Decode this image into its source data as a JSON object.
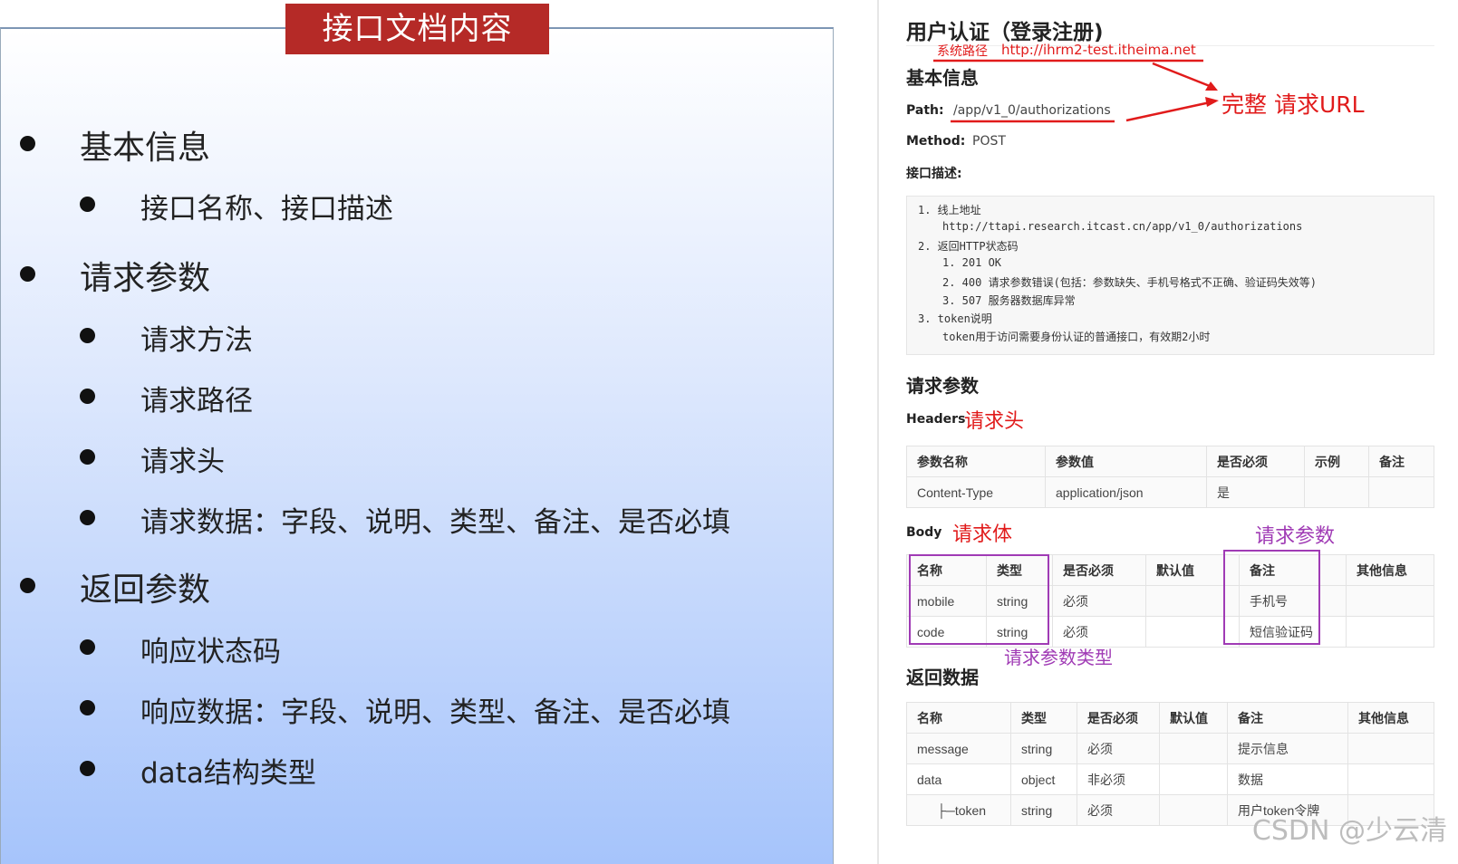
{
  "left": {
    "title": "接口文档内容",
    "sections": [
      {
        "label": "基本信息",
        "items": [
          "接口名称、接口描述"
        ]
      },
      {
        "label": "请求参数",
        "items": [
          "请求方法",
          "请求路径",
          "请求头",
          "请求数据：字段、说明、类型、备注、是否必填"
        ]
      },
      {
        "label": "返回参数",
        "items": [
          "响应状态码",
          "响应数据：字段、说明、类型、备注、是否必填",
          "data结构类型"
        ]
      }
    ]
  },
  "doc": {
    "title": "用户认证（登录注册)",
    "system_path_label": "系统路径",
    "system_path_url": "http://ihrm2-test.itheima.net",
    "basic_info_heading": "基本信息",
    "path_label": "Path:",
    "path_value": "/app/v1_0/authorizations",
    "full_url_annotation": "完整 请求URL",
    "method_label": "Method:",
    "method_value": "POST",
    "desc_label": "接口描述:",
    "desc_lines": [
      "1. 线上地址",
      "http://ttapi.research.itcast.cn/app/v1_0/authorizations",
      "2. 返回HTTP状态码",
      "1. 201 OK",
      "2. 400 请求参数错误(包括：参数缺失、手机号格式不正确、验证码失效等)",
      "3. 507 服务器数据库异常",
      "3. token说明",
      "token用于访问需要身份认证的普通接口，有效期2小时"
    ],
    "req_params_heading": "请求参数",
    "headers_label": "Headers",
    "headers_annotation": "请求头",
    "headers_table": {
      "columns": [
        "参数名称",
        "参数值",
        "是否必须",
        "示例",
        "备注"
      ],
      "rows": [
        [
          "Content-Type",
          "application/json",
          "是",
          "",
          ""
        ]
      ]
    },
    "body_label": "Body",
    "body_annotation": "请求体",
    "params_annotation": "请求参数",
    "param_type_annotation": "请求参数类型",
    "body_table": {
      "columns": [
        "名称",
        "类型",
        "是否必须",
        "默认值",
        "备注",
        "其他信息"
      ],
      "rows": [
        [
          "mobile",
          "string",
          "必须",
          "",
          "手机号",
          ""
        ],
        [
          "code",
          "string",
          "必须",
          "",
          "短信验证码",
          ""
        ]
      ]
    },
    "return_heading": "返回数据",
    "return_table": {
      "columns": [
        "名称",
        "类型",
        "是否必须",
        "默认值",
        "备注",
        "其他信息"
      ],
      "rows": [
        [
          "message",
          "string",
          "必须",
          "",
          "提示信息",
          ""
        ],
        [
          "data",
          "object",
          "非必须",
          "",
          "数据",
          ""
        ],
        [
          "├─token",
          "string",
          "必须",
          "",
          "用户token令牌",
          ""
        ]
      ]
    }
  },
  "watermark": "CSDN @少云清",
  "colors": {
    "title_red": "#b52a27",
    "annotation_red": "#e11b1b",
    "annotation_purple": "#a03bb5"
  }
}
